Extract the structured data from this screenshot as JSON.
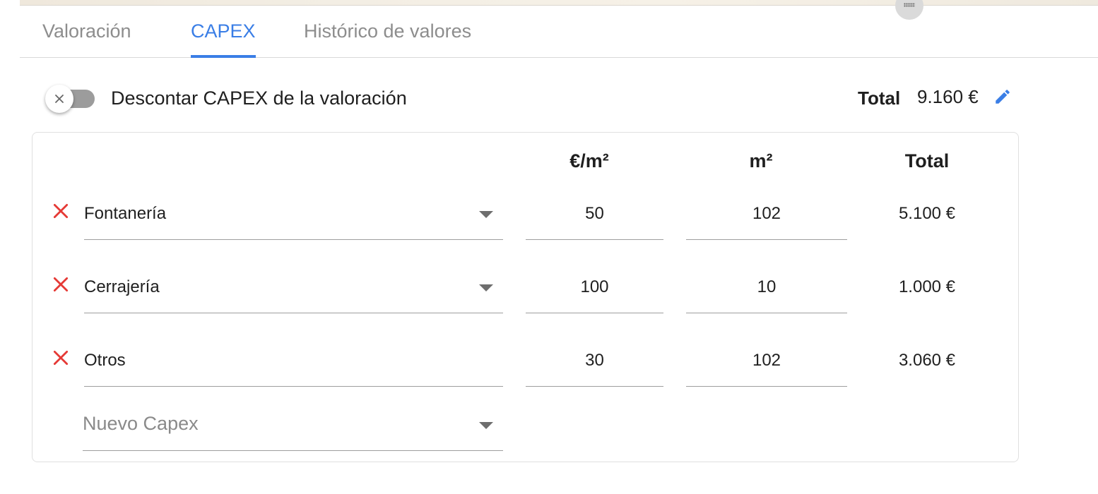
{
  "tabs": [
    {
      "label": "Valoración"
    },
    {
      "label": "CAPEX"
    },
    {
      "label": "Histórico de valores"
    }
  ],
  "toggle": {
    "label": "Descontar CAPEX de la valoración",
    "checked": false
  },
  "summary": {
    "total_label": "Total",
    "total_value": "9.160 €"
  },
  "table": {
    "headers": {
      "price": "€/m²",
      "area": "m²",
      "total": "Total"
    },
    "rows": [
      {
        "name": "Fontanería",
        "price": "50",
        "area": "102",
        "total": "5.100 €"
      },
      {
        "name": "Cerrajería",
        "price": "100",
        "area": "10",
        "total": "1.000 €"
      },
      {
        "name": "Otros",
        "price": "30",
        "area": "102",
        "total": "3.060 €"
      }
    ],
    "new_item_placeholder": "Nuevo Capex"
  },
  "colors": {
    "accent": "#3a7ee6",
    "delete": "#e53935",
    "toggle_off": "#9c9c9c"
  }
}
